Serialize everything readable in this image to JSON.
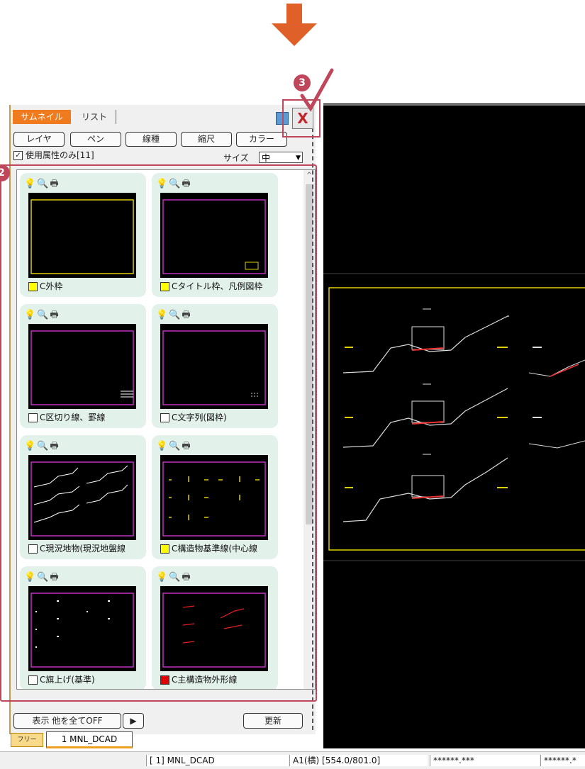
{
  "tabs": {
    "thumbnail": "サムネイル",
    "list": "リスト"
  },
  "categories": [
    "レイヤ",
    "ペン",
    "線種",
    "縮尺",
    "カラー"
  ],
  "used_only": {
    "checked": "✓",
    "label": "使用属性のみ[11]"
  },
  "size": {
    "label": "サイズ",
    "value": "中",
    "arrow": "▼"
  },
  "layers": [
    {
      "name": "C外枠",
      "color": "#ffff00",
      "icons": "💡🔍🖶"
    },
    {
      "name": "Cタイトル枠、凡例図枠",
      "color": "#ffff00",
      "icons": "💡🔍🖶"
    },
    {
      "name": "C区切り線、罫線",
      "color": "#ffffff",
      "icons": "💡🔍🖶"
    },
    {
      "name": "C文字列(図枠)",
      "color": "#ffffff",
      "icons": "💡🔍🖶"
    },
    {
      "name": "C現況地物(現況地盤線",
      "color": "#ffffff",
      "icons": "💡🔍🖶"
    },
    {
      "name": "C構造物基準線(中心線",
      "color": "#ffff00",
      "icons": "💡🔍🖶"
    },
    {
      "name": "C旗上げ(基準)",
      "color": "#ffffff",
      "icons": "💡🔍🖶"
    },
    {
      "name": "C主構造物外形線",
      "color": "#e00000",
      "icons": "💡🔍🖶"
    }
  ],
  "bottom": {
    "toggle_label": "表示 他を全てOFF",
    "play": "▶",
    "refresh": "更新"
  },
  "doc_tabs": {
    "free": "フリー",
    "doc": "1 MNL_DCAD"
  },
  "status": [
    "[ 1] MNL_DCAD",
    "A1(横) [554.0/801.0]",
    "******.***",
    "******.*"
  ],
  "callouts": {
    "two": "2",
    "three": "3"
  },
  "close_label": "X",
  "colors": {
    "accent": "#c0465c",
    "tab_active": "#f07a1e",
    "arrow": "#e0602a"
  }
}
